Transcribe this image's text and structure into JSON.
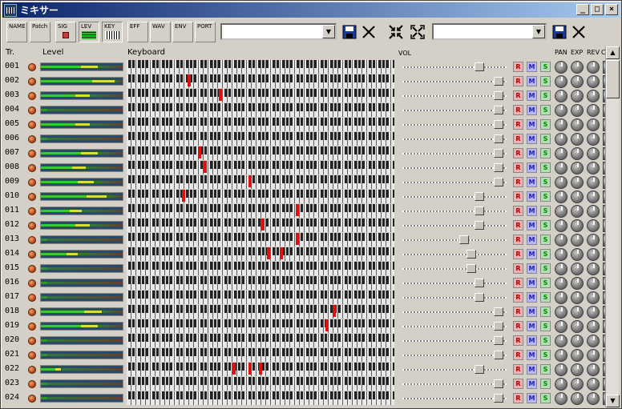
{
  "window": {
    "title": "ミキサー",
    "min": "_",
    "max": "□",
    "close": "×"
  },
  "toolbar": {
    "buttons": [
      "NAME",
      "Patch",
      "SIG",
      "LEV",
      "KEY",
      "EFF",
      "WAV",
      "ENV",
      "PORT"
    ],
    "combo1_value": "",
    "combo2_value": "",
    "combo_arrow": "▼"
  },
  "header": {
    "tr": "Tr.",
    "level": "Level",
    "keyboard": "Keyboard",
    "vol": "VOL",
    "pan": "PAN",
    "exp": "EXP",
    "rev": "REV",
    "cho": "C"
  },
  "tracks": [
    {
      "num": "001",
      "level": 0.7,
      "vol": 0.76,
      "notes": []
    },
    {
      "num": "002",
      "level": 0.9,
      "vol": 0.97,
      "notes": [
        0.23
      ]
    },
    {
      "num": "003",
      "level": 0.6,
      "vol": 0.97,
      "notes": [
        0.35
      ]
    },
    {
      "num": "004",
      "level": 0.0,
      "vol": 0.97,
      "notes": []
    },
    {
      "num": "005",
      "level": 0.6,
      "vol": 0.97,
      "notes": []
    },
    {
      "num": "006",
      "level": 0.0,
      "vol": 0.97,
      "notes": []
    },
    {
      "num": "007",
      "level": 0.7,
      "vol": 0.97,
      "notes": [
        0.27
      ]
    },
    {
      "num": "008",
      "level": 0.55,
      "vol": 0.97,
      "notes": [
        0.29
      ]
    },
    {
      "num": "009",
      "level": 0.65,
      "vol": 0.97,
      "notes": [
        0.46
      ]
    },
    {
      "num": "010",
      "level": 0.8,
      "vol": 0.76,
      "notes": [
        0.21
      ]
    },
    {
      "num": "011",
      "level": 0.5,
      "vol": 0.76,
      "notes": [
        0.64
      ]
    },
    {
      "num": "012",
      "level": 0.6,
      "vol": 0.76,
      "notes": [
        0.51
      ]
    },
    {
      "num": "013",
      "level": 0.0,
      "vol": 0.6,
      "notes": [
        0.64
      ]
    },
    {
      "num": "014",
      "level": 0.45,
      "vol": 0.68,
      "notes": [
        0.53,
        0.58
      ]
    },
    {
      "num": "015",
      "level": 0.0,
      "vol": 0.68,
      "notes": []
    },
    {
      "num": "016",
      "level": 0.0,
      "vol": 0.76,
      "notes": []
    },
    {
      "num": "017",
      "level": 0.0,
      "vol": 0.76,
      "notes": []
    },
    {
      "num": "018",
      "level": 0.75,
      "vol": 0.97,
      "notes": [
        0.78
      ]
    },
    {
      "num": "019",
      "level": 0.7,
      "vol": 0.97,
      "notes": [
        0.75
      ]
    },
    {
      "num": "020",
      "level": 0.0,
      "vol": 0.97,
      "notes": []
    },
    {
      "num": "021",
      "level": 0.0,
      "vol": 0.97,
      "notes": []
    },
    {
      "num": "022",
      "level": 0.25,
      "vol": 0.76,
      "notes": [
        0.4,
        0.46,
        0.5
      ]
    },
    {
      "num": "023",
      "level": 0.0,
      "vol": 0.97,
      "notes": []
    },
    {
      "num": "024",
      "level": 0.0,
      "vol": 0.97,
      "notes": []
    }
  ],
  "labels": {
    "r": "R",
    "m": "M",
    "s": "S"
  },
  "scroll": {
    "up": "▲",
    "down": "▼"
  }
}
